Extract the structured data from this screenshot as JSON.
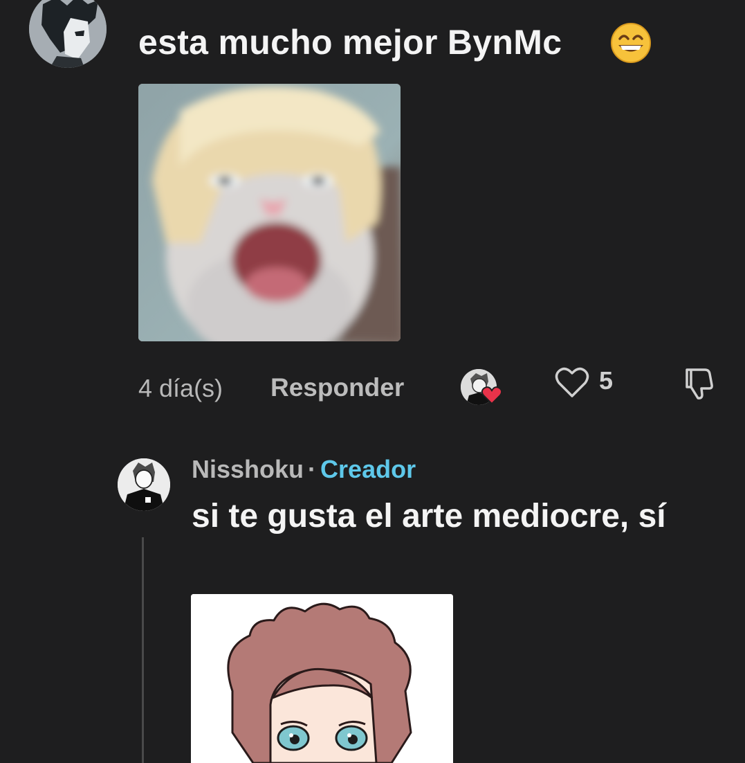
{
  "comment": {
    "text": "esta mucho mejor BynMc",
    "emoji": "grinning-face-with-smiling-eyes",
    "timestamp": "4 día(s)",
    "reply_label": "Responder",
    "like_count": "5"
  },
  "reply": {
    "author": "Nisshoku",
    "separator": "·",
    "role": "Creador",
    "text": "si te gusta el arte mediocre, sí"
  },
  "colors": {
    "background": "#1e1e1f",
    "creator_badge": "#5ec8ea",
    "heart": "#e8334a",
    "muted_text": "#b9b9b9"
  }
}
